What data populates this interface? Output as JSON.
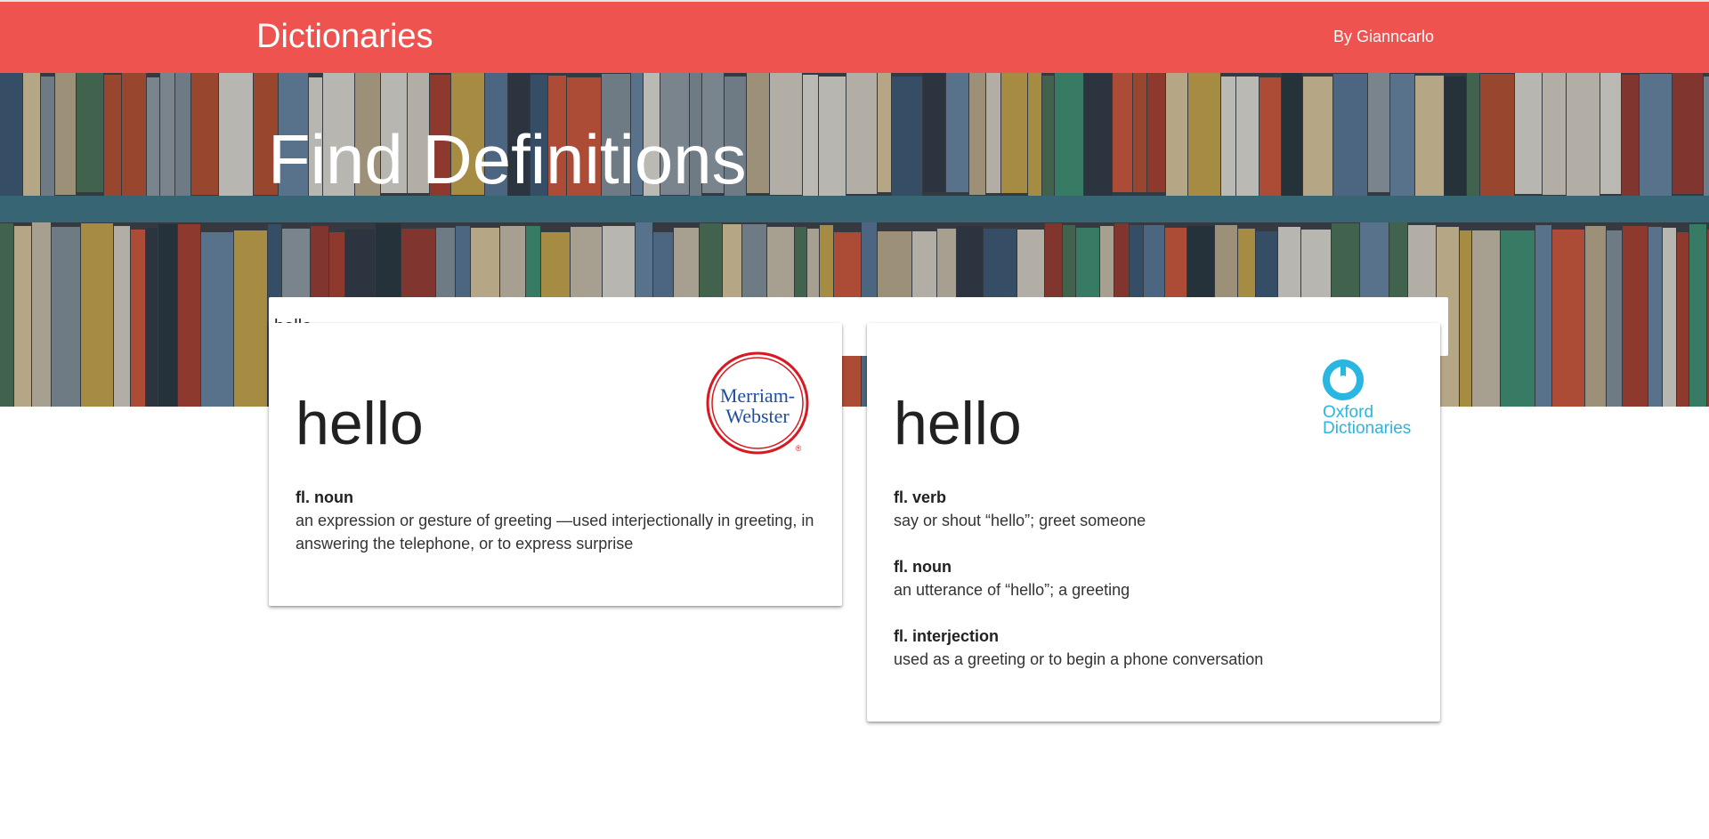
{
  "nav": {
    "brand": "Dictionaries",
    "author": "By Gianncarlo"
  },
  "hero": {
    "title": "Find Definitions"
  },
  "search": {
    "value": "hello"
  },
  "cards": [
    {
      "source": "Merriam-Webster",
      "logo_line1": "Merriam-",
      "logo_line2": "Webster",
      "logo_mark": "®",
      "word": "hello",
      "definitions": [
        {
          "pos": "fl. noun",
          "text": "an expression or gesture of greeting —used interjectionally in greeting, in answering the telephone, or to express surprise"
        }
      ]
    },
    {
      "source": "Oxford Dictionaries",
      "logo_line1": "Oxford",
      "logo_line2": "Dictionaries",
      "word": "hello",
      "definitions": [
        {
          "pos": "fl. verb",
          "text": "say or shout “hello”; greet someone"
        },
        {
          "pos": "fl. noun",
          "text": "an utterance of “hello”; a greeting"
        },
        {
          "pos": "fl. interjection",
          "text": "used as a greeting or to begin a phone conversation"
        }
      ]
    }
  ],
  "colors": {
    "nav_bg": "#ef5350",
    "mw_red": "#d71920",
    "mw_blue": "#1f4e9c",
    "oxford_blue": "#29b6e0"
  }
}
